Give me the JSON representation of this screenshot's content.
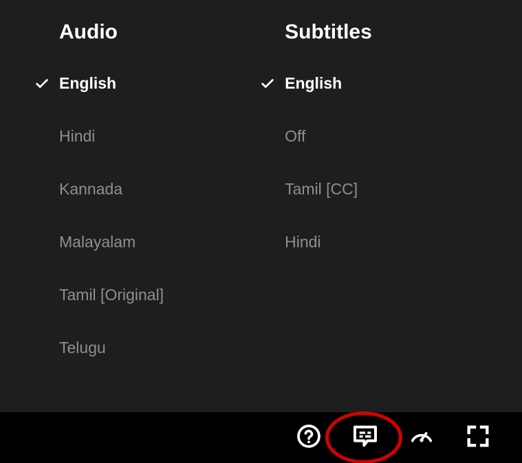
{
  "audio": {
    "title": "Audio",
    "options": [
      {
        "label": "English",
        "selected": true
      },
      {
        "label": "Hindi",
        "selected": false
      },
      {
        "label": "Kannada",
        "selected": false
      },
      {
        "label": "Malayalam",
        "selected": false
      },
      {
        "label": "Tamil [Original]",
        "selected": false
      },
      {
        "label": "Telugu",
        "selected": false
      }
    ]
  },
  "subtitles": {
    "title": "Subtitles",
    "options": [
      {
        "label": "English",
        "selected": true
      },
      {
        "label": "Off",
        "selected": false
      },
      {
        "label": "Tamil [CC]",
        "selected": false
      },
      {
        "label": "Hindi",
        "selected": false
      }
    ]
  },
  "toolbar": {
    "help_icon": "help-icon",
    "subtitles_icon": "subtitles-icon",
    "speed_icon": "speed-icon",
    "fullscreen_icon": "fullscreen-icon",
    "highlighted": "subtitles-icon"
  }
}
